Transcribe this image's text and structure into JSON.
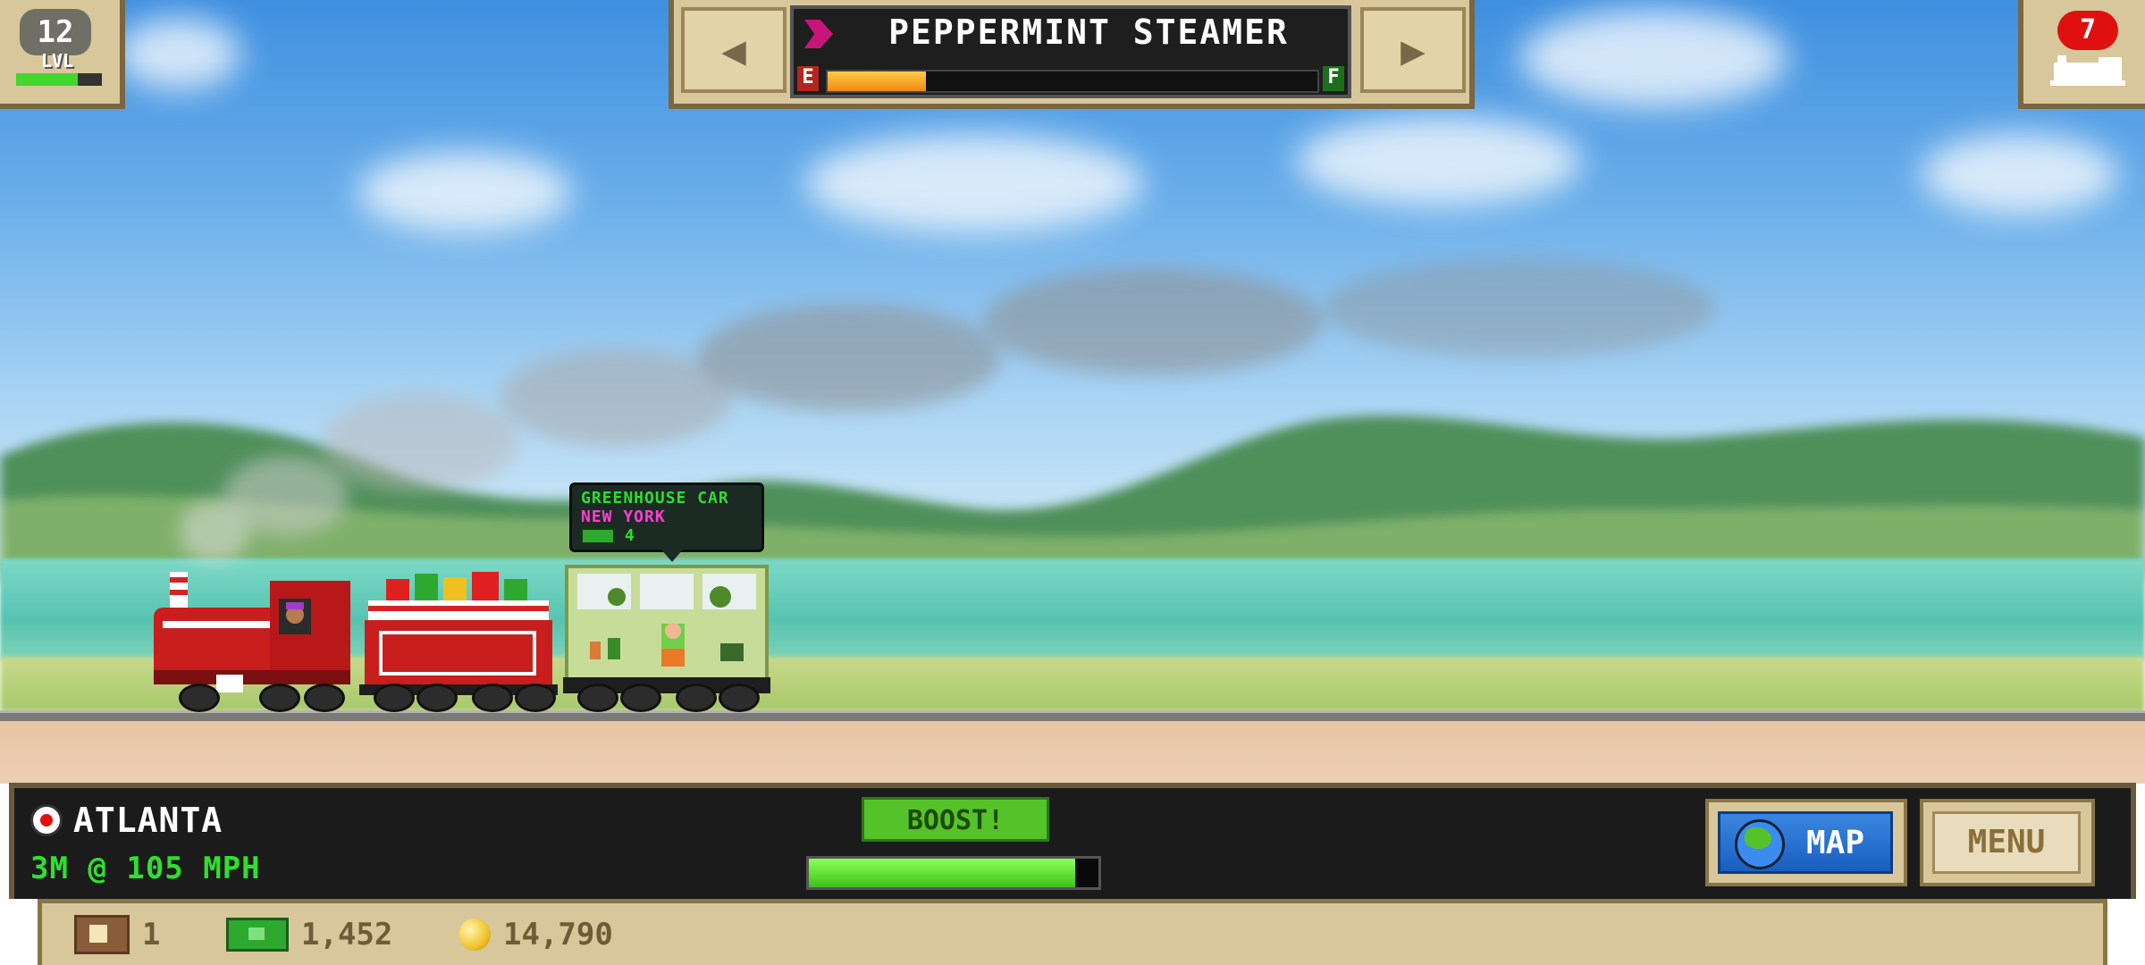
{
  "top": {
    "level": "12",
    "level_label": "LVL",
    "level_progress": 0.72,
    "prev_arrow": "◀",
    "next_arrow": "▶",
    "train_name": "PEPPERMINT STEAMER",
    "fuel_empty_label": "E",
    "fuel_full_label": "F",
    "fuel_level": 0.2,
    "tickets_count": "7"
  },
  "cargo_tooltip": {
    "car_type": "GREENHOUSE CAR",
    "destination": "NEW YORK",
    "quantity": "4"
  },
  "hud": {
    "station": "ATLANTA",
    "distance_speed": "3M @ 105 MPH",
    "boost_label": "BOOST!",
    "boost_level": 0.92,
    "map_label": "MAP",
    "menu_label": "MENU"
  },
  "resources": {
    "crates": "1",
    "cash": "1,452",
    "coins": "14,790"
  },
  "colors": {
    "accent_green": "#2fe02f",
    "destination_pink": "#ff3fd2",
    "map_blue": "#1a5ec0"
  },
  "icons": [
    "level-badge-icon",
    "train-icon",
    "ticket-train-icon",
    "station-icon",
    "globe-icon",
    "crate-icon",
    "cash-icon",
    "coin-icon",
    "cargo-icon"
  ]
}
